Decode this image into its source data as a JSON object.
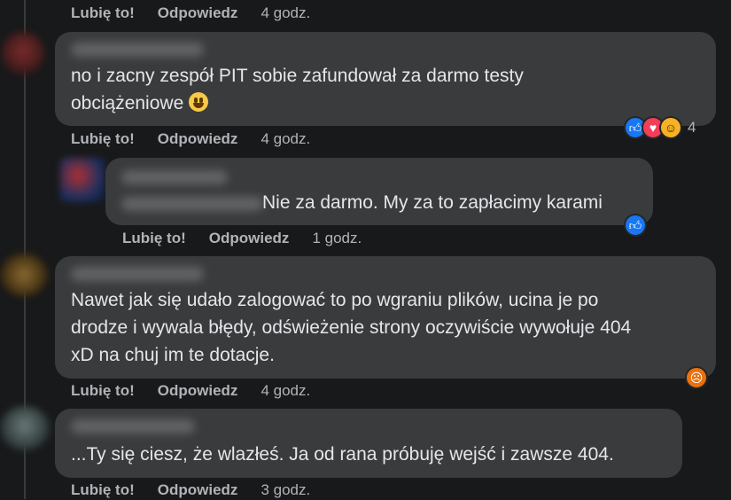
{
  "actions": {
    "like_label": "Lubię to!",
    "reply_label": "Odpowiedz"
  },
  "comments": [
    {
      "time": "4 godz."
    },
    {
      "text_line1": "no i zacny zespół PIT sobie zafundował za darmo testy",
      "text_line2": "obciążeniowe",
      "time": "4 godz.",
      "reactions": [
        "like-icon",
        "love-icon",
        "haha-icon"
      ],
      "reaction_count": "4"
    },
    {
      "text": "Nie za darmo. My za to zapłacimy karami",
      "time": "1 godz.",
      "reactions": [
        "like-icon"
      ]
    },
    {
      "text_line1": "Nawet jak się udało zalogować to po wgraniu plików, ucina je po",
      "text_line2": "drodze i wywala błędy, odświeżenie strony oczywiście wywołuje 404",
      "text_line3": "xD na chuj im te dotacje.",
      "time": "4 godz.",
      "reactions": [
        "angry-icon"
      ]
    },
    {
      "text": "...Ty się ciesz, że wlazłeś. Ja od rana próbuję wejść i zawsze 404.",
      "time": "3 godz."
    }
  ],
  "colors": {
    "background": "#18191a",
    "bubble": "#3a3b3c",
    "text": "#e4e6eb",
    "secondary_text": "#b0b3b8",
    "like_blue": "#1877f2",
    "love_red": "#f33e58",
    "haha_yellow": "#f7b125",
    "angry_orange": "#e9710f"
  }
}
